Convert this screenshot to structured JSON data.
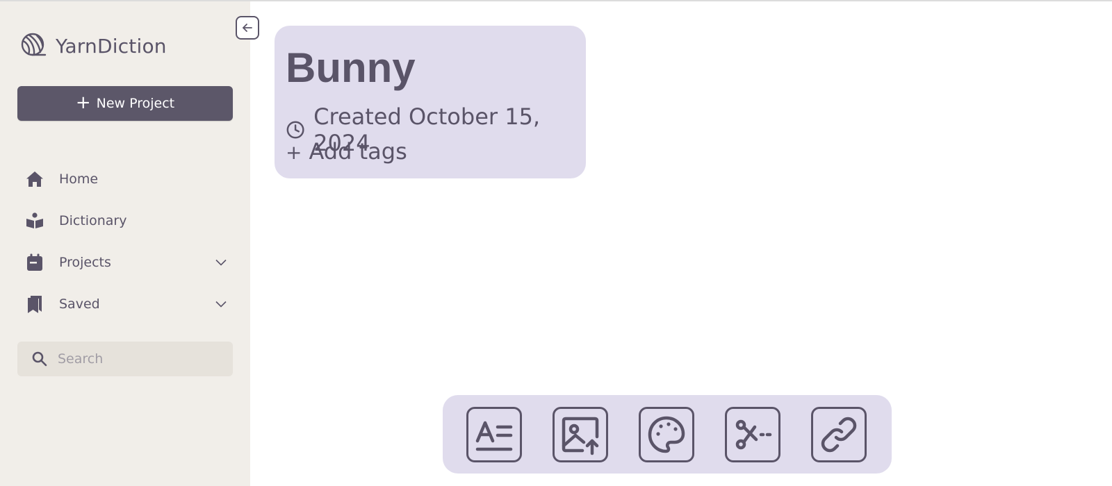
{
  "app": {
    "name": "YarnDiction"
  },
  "sidebar": {
    "new_project_label": "New Project",
    "items": [
      {
        "label": "Home",
        "icon": "home-icon"
      },
      {
        "label": "Dictionary",
        "icon": "book-reader-icon"
      },
      {
        "label": "Projects",
        "icon": "calendar-icon",
        "expandable": true
      },
      {
        "label": "Saved",
        "icon": "bookmark-icon",
        "expandable": true
      }
    ],
    "search": {
      "placeholder": "Search",
      "value": ""
    }
  },
  "project": {
    "title": "Bunny",
    "created": "Created October 15, 2024",
    "add_tags": "Add tags"
  },
  "toolbar": {
    "tools": [
      {
        "name": "text-tool",
        "icon": "text-format-icon"
      },
      {
        "name": "image-upload-tool",
        "icon": "image-upload-icon"
      },
      {
        "name": "color-palette-tool",
        "icon": "palette-icon"
      },
      {
        "name": "cut-tool",
        "icon": "scissors-icon"
      },
      {
        "name": "link-tool",
        "icon": "link-icon"
      }
    ]
  },
  "colors": {
    "accent": "#5c5769",
    "sidebar_bg": "#f1eee9",
    "card_bg": "#e0dced",
    "text": "#5a5468",
    "search_bg": "#e6e2db"
  }
}
